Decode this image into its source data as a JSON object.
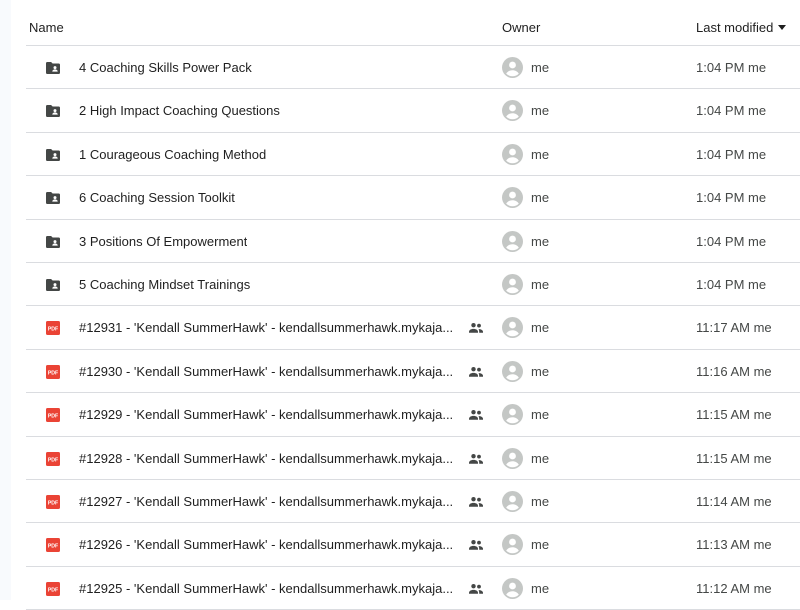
{
  "header": {
    "name_label": "Name",
    "owner_label": "Owner",
    "modified_label": "Last modified"
  },
  "rows": [
    {
      "type": "shared-folder",
      "name": "4 Coaching Skills Power Pack",
      "shared": false,
      "owner": "me",
      "modified": "1:04 PM me"
    },
    {
      "type": "shared-folder",
      "name": "2 High Impact Coaching Questions",
      "shared": false,
      "owner": "me",
      "modified": "1:04 PM me"
    },
    {
      "type": "shared-folder",
      "name": "1 Courageous Coaching Method",
      "shared": false,
      "owner": "me",
      "modified": "1:04 PM me"
    },
    {
      "type": "shared-folder",
      "name": "6 Coaching Session Toolkit",
      "shared": false,
      "owner": "me",
      "modified": "1:04 PM me"
    },
    {
      "type": "shared-folder",
      "name": "3 Positions Of Empowerment",
      "shared": false,
      "owner": "me",
      "modified": "1:04 PM me"
    },
    {
      "type": "shared-folder",
      "name": "5 Coaching Mindset Trainings",
      "shared": false,
      "owner": "me",
      "modified": "1:04 PM me"
    },
    {
      "type": "pdf",
      "name": "#12931 - 'Kendall SummerHawk' - kendallsummerhawk.mykaja...",
      "shared": true,
      "owner": "me",
      "modified": "11:17 AM me"
    },
    {
      "type": "pdf",
      "name": "#12930 - 'Kendall SummerHawk' - kendallsummerhawk.mykaja...",
      "shared": true,
      "owner": "me",
      "modified": "11:16 AM me"
    },
    {
      "type": "pdf",
      "name": "#12929 - 'Kendall SummerHawk' - kendallsummerhawk.mykaja...",
      "shared": true,
      "owner": "me",
      "modified": "11:15 AM me"
    },
    {
      "type": "pdf",
      "name": "#12928 - 'Kendall SummerHawk' - kendallsummerhawk.mykaja...",
      "shared": true,
      "owner": "me",
      "modified": "11:15 AM me"
    },
    {
      "type": "pdf",
      "name": "#12927 - 'Kendall SummerHawk' - kendallsummerhawk.mykaja...",
      "shared": true,
      "owner": "me",
      "modified": "11:14 AM me"
    },
    {
      "type": "pdf",
      "name": "#12926 - 'Kendall SummerHawk' - kendallsummerhawk.mykaja...",
      "shared": true,
      "owner": "me",
      "modified": "11:13 AM me"
    },
    {
      "type": "pdf",
      "name": "#12925 - 'Kendall SummerHawk' - kendallsummerhawk.mykaja...",
      "shared": true,
      "owner": "me",
      "modified": "11:12 AM me"
    }
  ],
  "icons": {
    "folder": "shared-folder-icon",
    "pdf": "pdf-icon",
    "shared": "people-icon",
    "avatar": "avatar-icon"
  },
  "colors": {
    "folder": "#444746",
    "pdf": "#ea4335",
    "avatar": "#c4c7c5",
    "divider": "#dadce0"
  }
}
